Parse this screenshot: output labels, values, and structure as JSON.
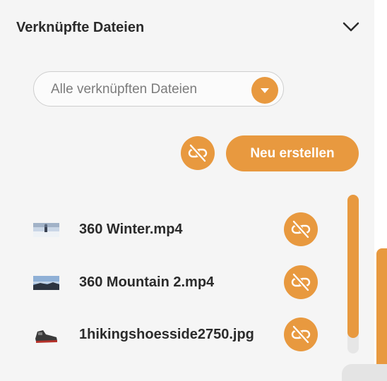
{
  "panel": {
    "title": "Verknüpfte Dateien",
    "collapse_icon": "chevron-down-icon"
  },
  "filter": {
    "selected": "Alle verknüpften Dateien",
    "arrow_icon": "caret-down-icon"
  },
  "actions": {
    "unlink_all_icon": "unlink-icon",
    "create_label": "Neu erstellen"
  },
  "files": [
    {
      "name": "360 Winter.mp4",
      "thumbnail": "snow-scene",
      "unlink_icon": "unlink-icon"
    },
    {
      "name": "360 Mountain 2.mp4",
      "thumbnail": "mountain-scene",
      "unlink_icon": "unlink-icon"
    },
    {
      "name": "1hikingshoesside2750.jpg",
      "thumbnail": "hiking-shoe",
      "unlink_icon": "unlink-icon"
    }
  ],
  "colors": {
    "accent": "#e8993f",
    "text": "#2b2b2b",
    "placeholder": "#7c7c7c",
    "background": "#f5f5f5"
  }
}
